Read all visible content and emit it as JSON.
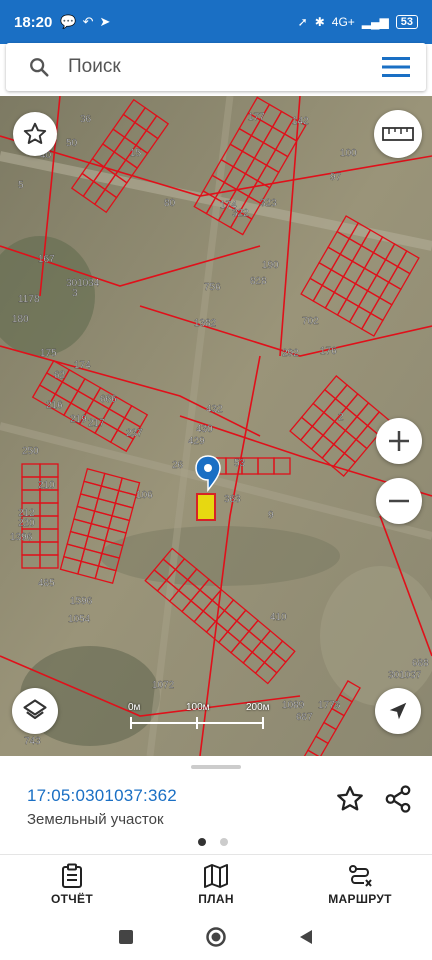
{
  "status_bar": {
    "time": "18:20",
    "network_label": "4G+",
    "battery": "53"
  },
  "search": {
    "placeholder": "Поиск"
  },
  "map": {
    "parcel_labels": [
      "36",
      "50",
      "40",
      "15",
      "5",
      "80",
      "174",
      "177",
      "142",
      "100",
      "97",
      "301034",
      "3",
      "167",
      "1178",
      "180",
      "175",
      "174",
      "62",
      "666",
      "216",
      "219",
      "217",
      "237",
      "250",
      "210",
      "212",
      "220",
      "1396",
      "485",
      "1596",
      "1054",
      "1382",
      "756",
      "828",
      "702",
      "292",
      "432",
      "430",
      "429",
      "53",
      "26",
      "106",
      "363",
      "9",
      "2",
      "176",
      "190",
      "322",
      "323",
      "410",
      "743",
      "1072",
      "688",
      "687",
      "1773",
      "1089",
      "301037"
    ],
    "selected_parcel": "363",
    "scale": {
      "labels": [
        "0м",
        "100м",
        "200м"
      ]
    }
  },
  "parcel_card": {
    "cadastral_number": "17:05:0301037:362",
    "type": "Земельный участок"
  },
  "bottom_nav": {
    "items": [
      {
        "label": "ОТЧЁТ",
        "icon": "report-icon"
      },
      {
        "label": "ПЛАН",
        "icon": "map-plan-icon"
      },
      {
        "label": "МАРШРУТ",
        "icon": "route-icon"
      }
    ]
  },
  "colors": {
    "brand": "#1a6fc4",
    "parcel_border": "#e0101a",
    "selected_fill": "#f5e500"
  }
}
